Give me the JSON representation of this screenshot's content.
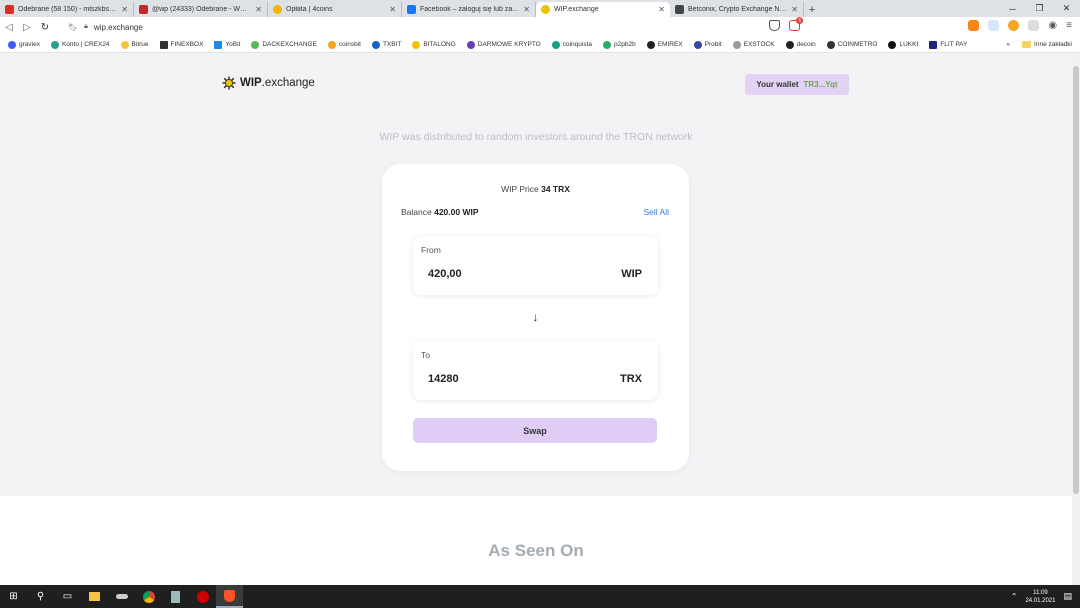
{
  "browser": {
    "tabs": [
      {
        "title": "Odebrane (58 150) - mtszkbs018...",
        "color": "#d93025",
        "active": false
      },
      {
        "title": "@wp (24333) Odebrane - WP Poc...",
        "color": "#c62828",
        "active": false
      },
      {
        "title": "Opłata | 4coins",
        "color": "#f5b400",
        "active": false
      },
      {
        "title": "Facebook – zaloguj się lub zarejes...",
        "color": "#1877f2",
        "active": false
      },
      {
        "title": "WIP.exchange",
        "color": "#e8c400",
        "active": true
      },
      {
        "title": "Betconix, Crypto Exchange Nº1, Bi...",
        "color": "#444444",
        "active": false
      }
    ],
    "url": "wip.exchange",
    "notif_count": "6",
    "bookmarks": [
      {
        "label": "graviex",
        "color": "#3d5afe"
      },
      {
        "label": "Konto | CREX24",
        "color": "#2a9d8f"
      },
      {
        "label": "Bitrue",
        "color": "#f6c23e"
      },
      {
        "label": "FINEXBOX",
        "color": "#333333"
      },
      {
        "label": "YoBit",
        "color": "#1e88e5"
      },
      {
        "label": "DACKEXCHANGE",
        "color": "#5ab85a"
      },
      {
        "label": "coinsbit",
        "color": "#f5a623"
      },
      {
        "label": "TXBIT",
        "color": "#1565c0"
      },
      {
        "label": "BITALONG",
        "color": "#f2c200"
      },
      {
        "label": "DARMOWE KRYPTO",
        "color": "#6a3fb5"
      },
      {
        "label": "coinquista",
        "color": "#16a085"
      },
      {
        "label": "p2pb2b",
        "color": "#27ae60"
      },
      {
        "label": "EMIREX",
        "color": "#222222"
      },
      {
        "label": "Probit",
        "color": "#3949ab"
      },
      {
        "label": "EXSTOCK",
        "color": "#999999"
      },
      {
        "label": "decoin",
        "color": "#222222"
      },
      {
        "label": "COINMETRO",
        "color": "#333333"
      },
      {
        "label": "LUKKI",
        "color": "#111111"
      },
      {
        "label": "FLIT PAY",
        "color": "#1a237e"
      }
    ],
    "more_label": "»",
    "other_bookmarks": "Inne zakładki"
  },
  "site": {
    "logo_bold": "WIP",
    "logo_rest": ".exchange",
    "wallet_label": "Your wallet",
    "wallet_address": "TR3...Yqt",
    "tagline": "WIP was distributed to random investors around the TRON network",
    "price_label": "WIP Price",
    "price_value": "34 TRX",
    "balance_label": "Balance",
    "balance_value": "420.00 WIP",
    "sell_all": "Sell All",
    "from_label": "From",
    "from_value": "420,00",
    "from_currency": "WIP",
    "to_label": "To",
    "to_value": "14280",
    "to_currency": "TRX",
    "swap_label": "Swap",
    "seen_on": "As Seen On"
  },
  "taskbar": {
    "time": "11:09",
    "date": "24.01.2021"
  }
}
